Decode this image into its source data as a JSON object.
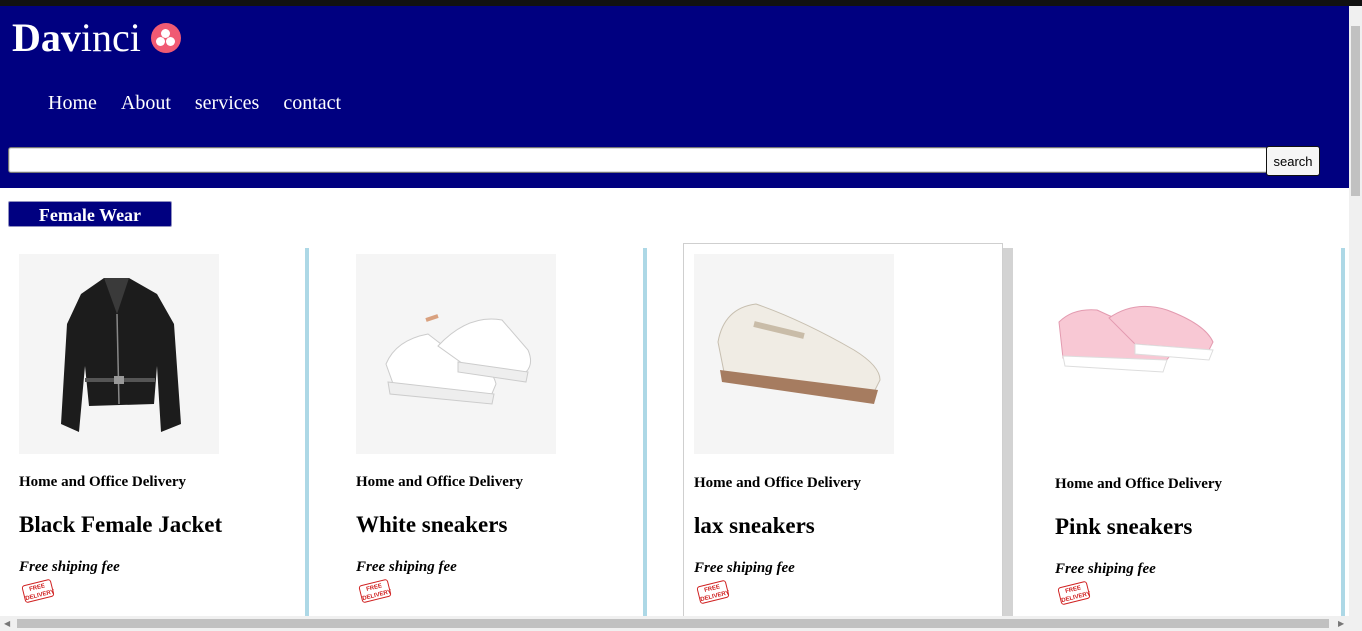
{
  "brand": {
    "name_bold": "Dav",
    "name_thin": "inci",
    "logo_icon": "clover-badge-icon",
    "badge_color": "#f05a73"
  },
  "nav": {
    "items": [
      "Home",
      "About",
      "services",
      "contact"
    ]
  },
  "search": {
    "value": "",
    "placeholder": "",
    "button_label": "search"
  },
  "category": {
    "label": "Female Wear"
  },
  "products": [
    {
      "image": "black-leather-jacket",
      "delivery": "Home and Office Delivery",
      "name": "Black Female Jacket",
      "shipping": "Free shiping fee",
      "badge": "FREE DELIVERY"
    },
    {
      "image": "white-sneakers",
      "delivery": "Home and Office Delivery",
      "name": "White sneakers",
      "shipping": "Free shiping fee",
      "badge": "FREE DELIVERY"
    },
    {
      "image": "beige-sneakers",
      "delivery": "Home and Office Delivery",
      "name": "lax sneakers",
      "shipping": "Free shiping fee",
      "badge": "FREE DELIVERY"
    },
    {
      "image": "pink-sneakers",
      "delivery": "Home and Office Delivery",
      "name": "Pink sneakers",
      "shipping": "Free shiping fee",
      "badge": "FREE DELIVERY"
    }
  ],
  "colors": {
    "header": "#000080",
    "divider": "#add8e6",
    "stamp": "#d02020"
  }
}
